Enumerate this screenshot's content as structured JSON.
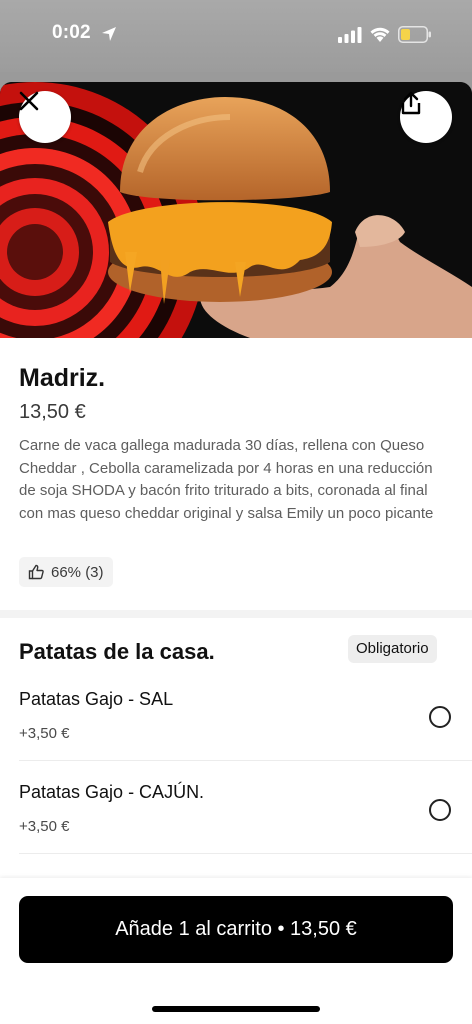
{
  "status_bar": {
    "time": "0:02",
    "icons": [
      "location-arrow-icon",
      "signal-icon",
      "wifi-icon",
      "battery-icon"
    ]
  },
  "hero": {
    "close_icon": "close-icon",
    "share_icon": "share-icon",
    "image_description_icon": "burger-photo"
  },
  "product": {
    "title": "Madriz.",
    "price": "13,50 €",
    "description": "Carne de vaca gallega madurada 30 días, rellena con Queso Cheddar , Cebolla caramelizada por 4 horas en una reducción de soja SHODA y bacón frito triturado a bits, coronada al final con mas queso cheddar original y salsa Emily un poco picante",
    "rating": "66% (3)"
  },
  "section": {
    "title": "Patatas de la casa.",
    "badge": "Obligatorio",
    "options": [
      {
        "name": "Patatas Gajo - SAL",
        "price": "+3,50 €",
        "selected": false
      },
      {
        "name": "Patatas Gajo - CAJÚN.",
        "price": "+3,50 €",
        "selected": false
      }
    ]
  },
  "cart": {
    "button_label": "Añade 1 al carrito • 13,50 €"
  },
  "colors": {
    "accent": "#000000",
    "badge_bg": "#eeeeee",
    "hero_red": "#e8231f"
  }
}
